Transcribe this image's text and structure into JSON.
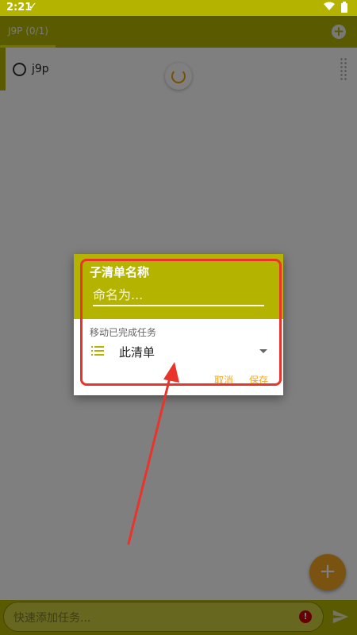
{
  "status_bar": {
    "time": "2:21",
    "check_icon": "check-icon",
    "wifi_icon": "wifi-icon",
    "battery_icon": "battery-icon"
  },
  "app_bar": {
    "tab_label": "J9P (0/1)",
    "add_icon": "add-circle-icon"
  },
  "task_list": {
    "items": [
      {
        "text": "j9p"
      }
    ]
  },
  "quick_add": {
    "placeholder": "快速添加任务...",
    "priority_icon": "priority-alert-icon",
    "send_icon": "send-icon"
  },
  "fab": {
    "label": "+"
  },
  "dialog": {
    "title": "子清单名称",
    "name_placeholder": "命名为...",
    "move_label": "移动已完成任务",
    "list_select_value": "此清单",
    "cancel_label": "取消",
    "save_label": "保存"
  },
  "colors": {
    "primary": "#b4b400",
    "accent": "#f5a623",
    "annotation": "#e8342a"
  }
}
